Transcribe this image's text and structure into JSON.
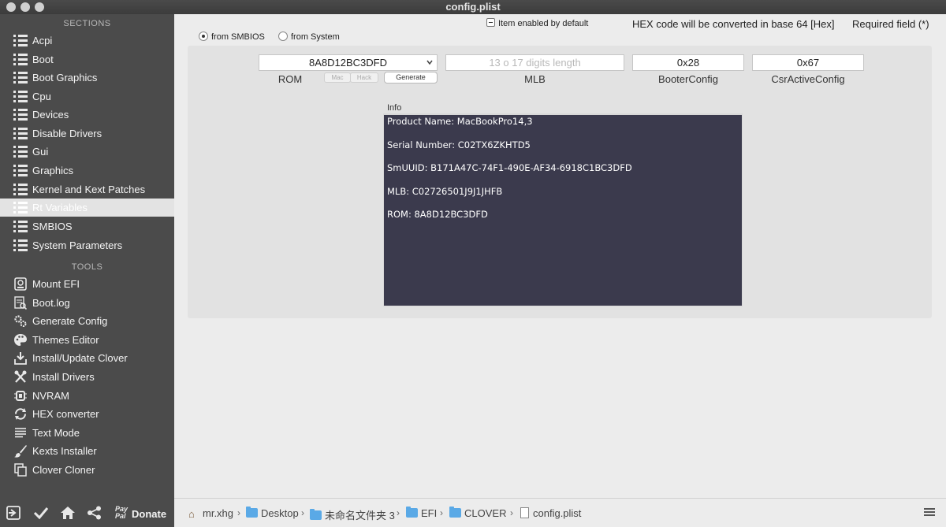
{
  "window": {
    "title": "config.plist"
  },
  "sidebar": {
    "sections_header": "SECTIONS",
    "sections": [
      {
        "label": "Acpi"
      },
      {
        "label": "Boot"
      },
      {
        "label": "Boot Graphics"
      },
      {
        "label": "Cpu"
      },
      {
        "label": "Devices"
      },
      {
        "label": "Disable Drivers"
      },
      {
        "label": "Gui"
      },
      {
        "label": "Graphics"
      },
      {
        "label": "Kernel and Kext Patches"
      },
      {
        "label": "Rt Variables",
        "selected": true
      },
      {
        "label": "SMBIOS"
      },
      {
        "label": "System Parameters"
      }
    ],
    "tools_header": "TOOLS",
    "tools": [
      {
        "label": "Mount EFI",
        "icon": "disk-icon"
      },
      {
        "label": "Boot.log",
        "icon": "log-icon"
      },
      {
        "label": "Generate Config",
        "icon": "gears-icon"
      },
      {
        "label": "Themes Editor",
        "icon": "palette-icon"
      },
      {
        "label": "Install/Update Clover",
        "icon": "download-icon"
      },
      {
        "label": "Install Drivers",
        "icon": "wrench-icon"
      },
      {
        "label": "NVRAM",
        "icon": "chip-icon"
      },
      {
        "label": "HEX converter",
        "icon": "refresh-icon"
      },
      {
        "label": "Text Mode",
        "icon": "text-lines-icon"
      },
      {
        "label": "Kexts Installer",
        "icon": "brush-icon"
      },
      {
        "label": "Clover Cloner",
        "icon": "clone-icon"
      }
    ],
    "bottom": {
      "paypal_text_1": "Pay",
      "paypal_text_2": "Pal",
      "donate_label": "Donate"
    }
  },
  "header": {
    "item_enabled_label": "Item enabled by default",
    "hex_note": "HEX code will be converted in base 64 [Hex]",
    "required_note": "Required field (*)",
    "radio_smbios": "from SMBIOS",
    "radio_system": "from System"
  },
  "fields": {
    "rom": {
      "value": "8A8D12BC3DFD",
      "label": "ROM"
    },
    "mac_label": "Mac",
    "hack_label": "Hack",
    "generate_label": "Generate",
    "mlb": {
      "placeholder": "13 o 17 digits length",
      "label": "MLB"
    },
    "booter_config": {
      "value": "0x28",
      "label": "BooterConfig"
    },
    "csr_active_config": {
      "value": "0x67",
      "label": "CsrActiveConfig"
    }
  },
  "info": {
    "label": "Info",
    "lines": [
      "Product Name: MacBookPro14,3",
      "Serial Number: C02TX6ZKHTD5",
      "SmUUID: B171A47C-74F1-490E-AF34-6918C1BC3DFD",
      "MLB: C02726501J9J1JHFB",
      "ROM: 8A8D12BC3DFD"
    ]
  },
  "pathbar": {
    "crumbs": [
      "mr.xhg",
      "Desktop",
      "未命名文件夹 3",
      "EFI",
      "CLOVER",
      "config.plist"
    ]
  }
}
